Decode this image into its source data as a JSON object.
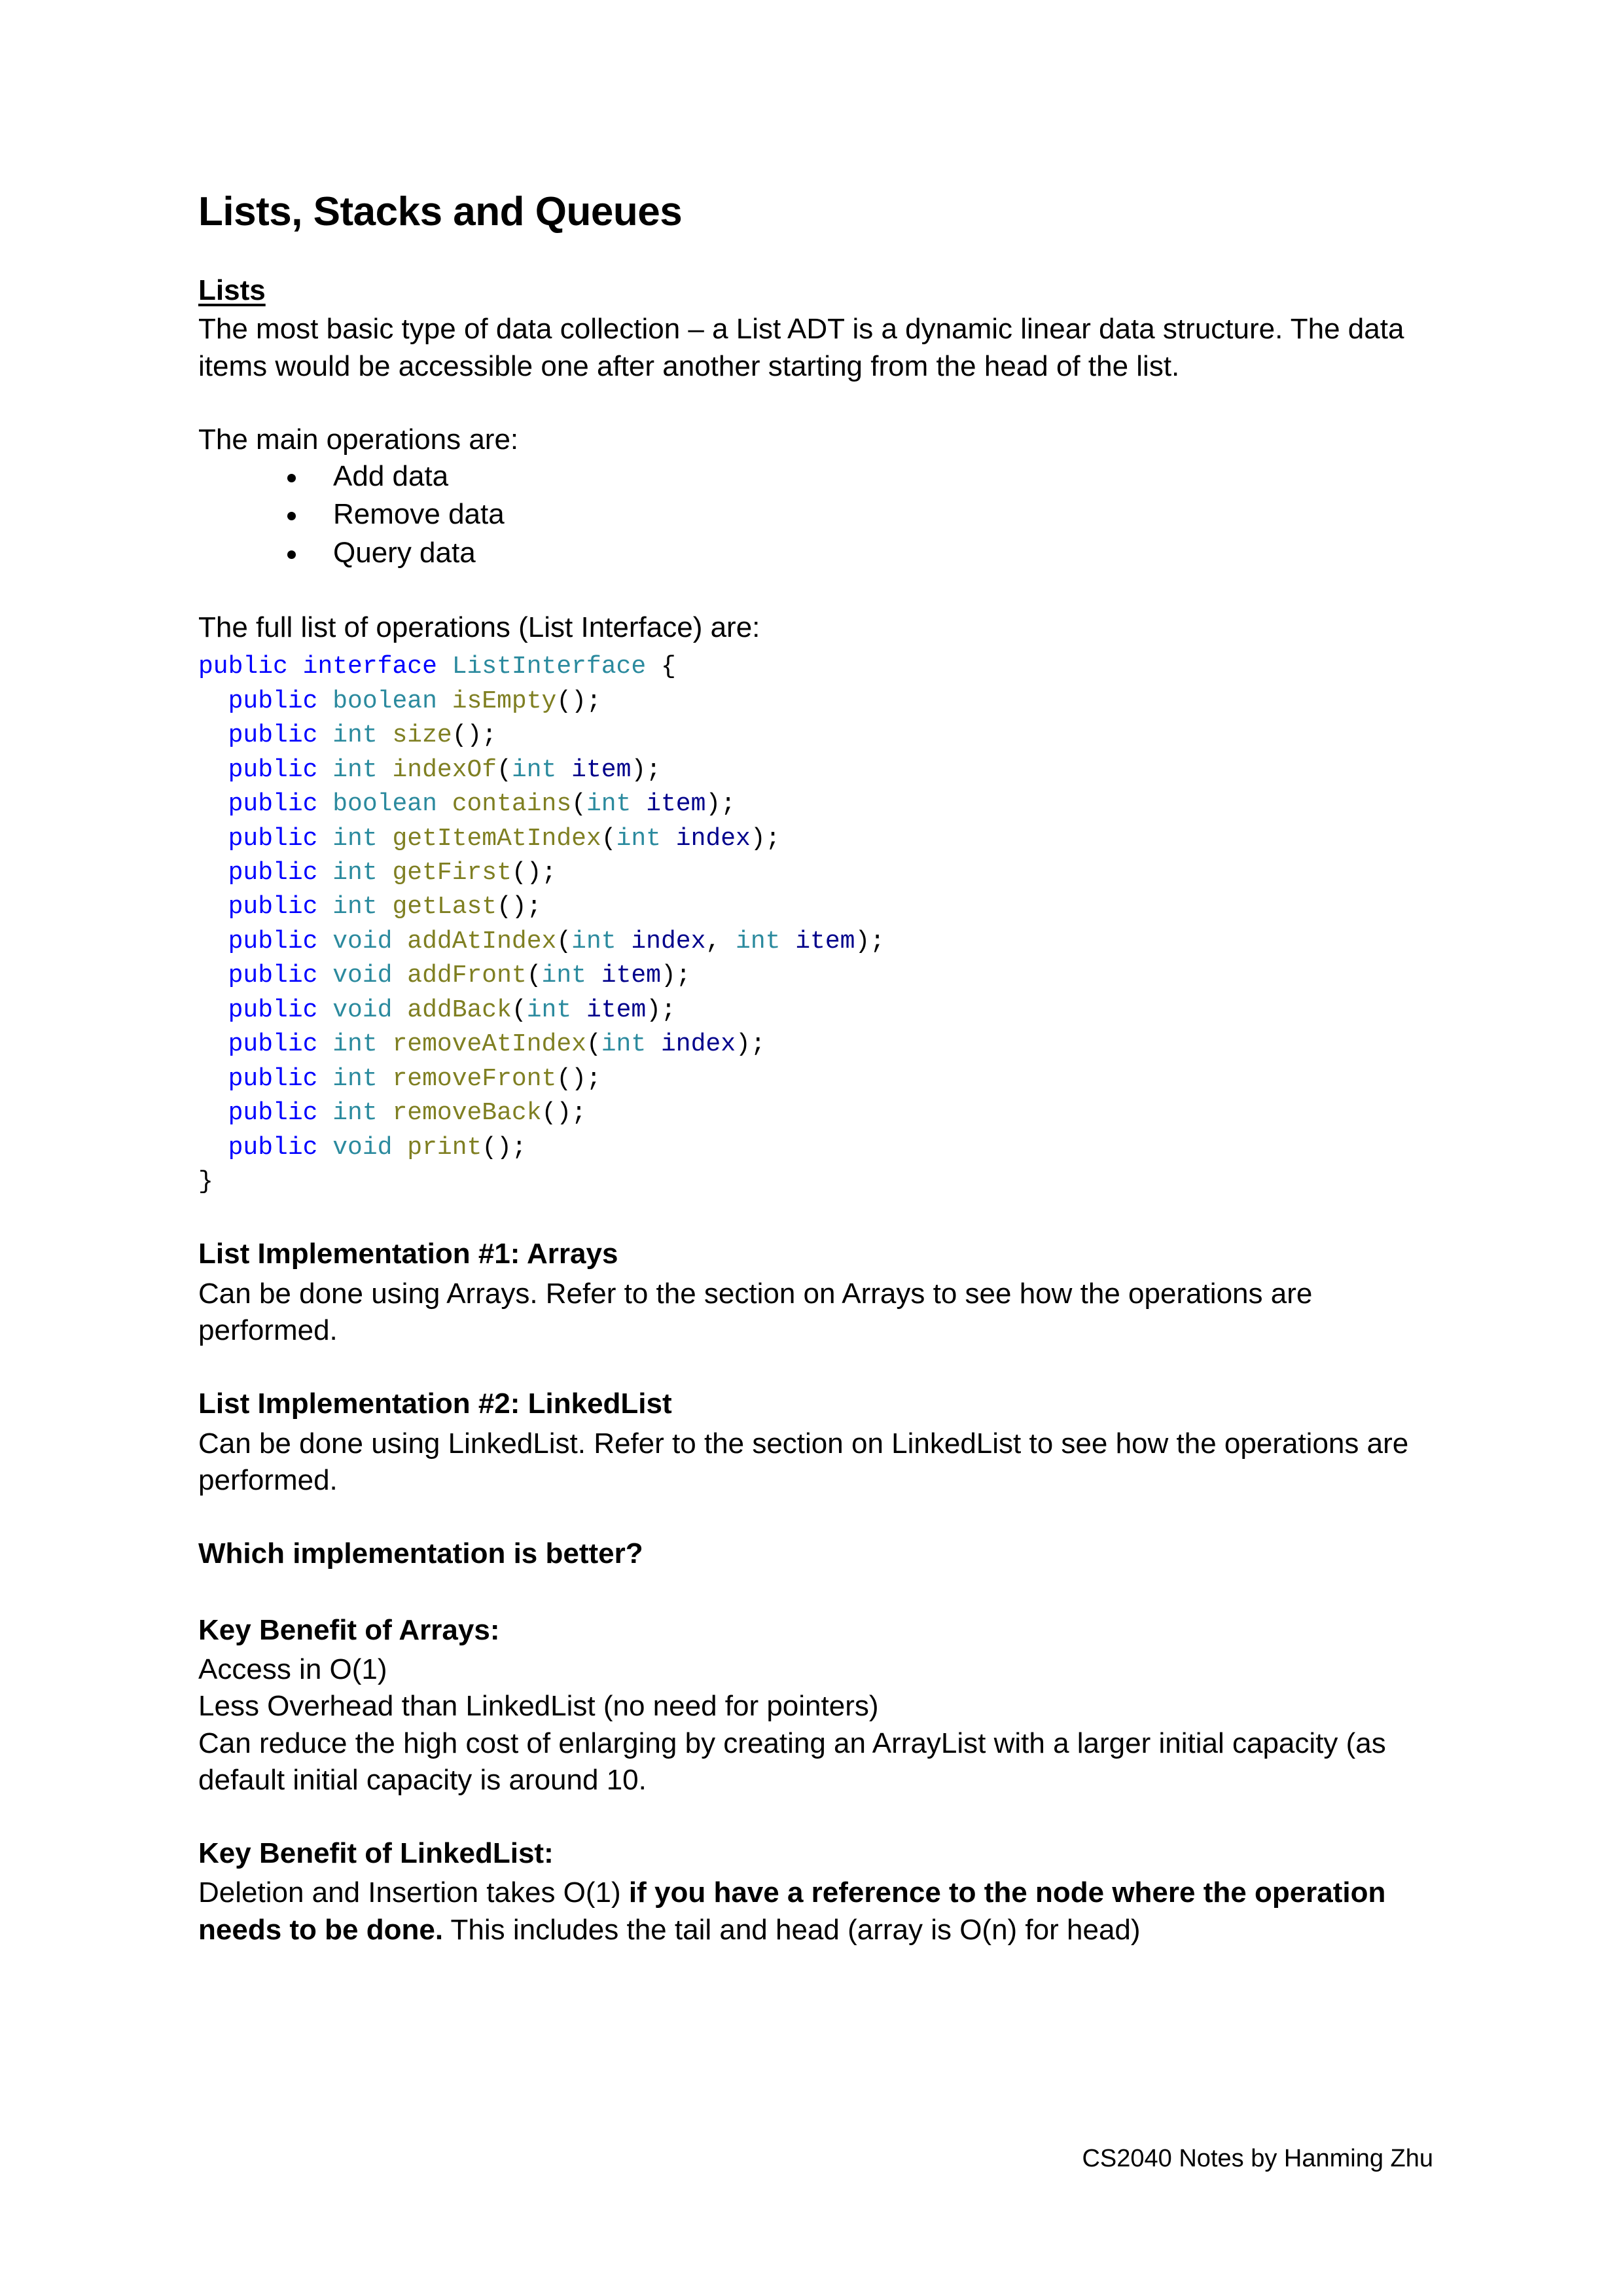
{
  "document": {
    "title": "Lists, Stacks and Queues",
    "footer": "CS2040 Notes by Hanming Zhu"
  },
  "sections": {
    "lists": {
      "heading": "Lists",
      "intro": "The most basic type of data collection – a List ADT is a dynamic linear data structure. The data items would be accessible one after another starting from the head of the list.",
      "operations_lead": "The main operations are:",
      "operations": [
        "Add data",
        "Remove data",
        "Query data"
      ],
      "full_list_lead": "The full list of operations (List Interface) are:"
    },
    "impl_arrays": {
      "heading": "List Implementation #1: Arrays",
      "body": "Can be done using Arrays. Refer to the section on Arrays to see how the operations are performed."
    },
    "impl_linkedlist": {
      "heading": "List Implementation #2: LinkedList",
      "body": "Can be done using LinkedList. Refer to the section on LinkedList to see how the operations are performed."
    },
    "which_better": {
      "heading": "Which implementation is better?"
    },
    "benefit_arrays": {
      "heading": "Key Benefit of Arrays:",
      "line1": "Access in O(1)",
      "line2": "Less Overhead than LinkedList (no need for pointers)",
      "line3": "Can reduce the high cost of enlarging by creating an ArrayList with a larger initial capacity (as default initial capacity is around 10."
    },
    "benefit_linkedlist": {
      "heading": "Key Benefit of LinkedList:",
      "part1": "Deletion and Insertion takes O(1) ",
      "part2_bold": "if you have a reference to the node where the operation needs to be done.",
      "part3": " This includes the tail and head (array is O(n) for head)"
    }
  },
  "code_block": {
    "language": "java",
    "colors": {
      "keyword": "#0000ff",
      "type": "#2b8a9e",
      "method": "#7f7f22",
      "parameter": "#00008b",
      "punctuation": "#000000"
    },
    "lines": [
      [
        {
          "t": "public",
          "c": "kw"
        },
        {
          "t": " ",
          "c": "pun"
        },
        {
          "t": "interface",
          "c": "kw"
        },
        {
          "t": " ",
          "c": "pun"
        },
        {
          "t": "ListInterface",
          "c": "typ"
        },
        {
          "t": " {",
          "c": "pun"
        }
      ],
      [
        {
          "t": "  ",
          "c": "pun"
        },
        {
          "t": "public",
          "c": "kw"
        },
        {
          "t": " ",
          "c": "pun"
        },
        {
          "t": "boolean",
          "c": "typ"
        },
        {
          "t": " ",
          "c": "pun"
        },
        {
          "t": "isEmpty",
          "c": "mth"
        },
        {
          "t": "();",
          "c": "pun"
        }
      ],
      [
        {
          "t": "  ",
          "c": "pun"
        },
        {
          "t": "public",
          "c": "kw"
        },
        {
          "t": " ",
          "c": "pun"
        },
        {
          "t": "int",
          "c": "typ"
        },
        {
          "t": " ",
          "c": "pun"
        },
        {
          "t": "size",
          "c": "mth"
        },
        {
          "t": "();",
          "c": "pun"
        }
      ],
      [
        {
          "t": "  ",
          "c": "pun"
        },
        {
          "t": "public",
          "c": "kw"
        },
        {
          "t": " ",
          "c": "pun"
        },
        {
          "t": "int",
          "c": "typ"
        },
        {
          "t": " ",
          "c": "pun"
        },
        {
          "t": "indexOf",
          "c": "mth"
        },
        {
          "t": "(",
          "c": "pun"
        },
        {
          "t": "int",
          "c": "typ"
        },
        {
          "t": " ",
          "c": "pun"
        },
        {
          "t": "item",
          "c": "prm"
        },
        {
          "t": ");",
          "c": "pun"
        }
      ],
      [
        {
          "t": "  ",
          "c": "pun"
        },
        {
          "t": "public",
          "c": "kw"
        },
        {
          "t": " ",
          "c": "pun"
        },
        {
          "t": "boolean",
          "c": "typ"
        },
        {
          "t": " ",
          "c": "pun"
        },
        {
          "t": "contains",
          "c": "mth"
        },
        {
          "t": "(",
          "c": "pun"
        },
        {
          "t": "int",
          "c": "typ"
        },
        {
          "t": " ",
          "c": "pun"
        },
        {
          "t": "item",
          "c": "prm"
        },
        {
          "t": ");",
          "c": "pun"
        }
      ],
      [
        {
          "t": "  ",
          "c": "pun"
        },
        {
          "t": "public",
          "c": "kw"
        },
        {
          "t": " ",
          "c": "pun"
        },
        {
          "t": "int",
          "c": "typ"
        },
        {
          "t": " ",
          "c": "pun"
        },
        {
          "t": "getItemAtIndex",
          "c": "mth"
        },
        {
          "t": "(",
          "c": "pun"
        },
        {
          "t": "int",
          "c": "typ"
        },
        {
          "t": " ",
          "c": "pun"
        },
        {
          "t": "index",
          "c": "prm"
        },
        {
          "t": ");",
          "c": "pun"
        }
      ],
      [
        {
          "t": "  ",
          "c": "pun"
        },
        {
          "t": "public",
          "c": "kw"
        },
        {
          "t": " ",
          "c": "pun"
        },
        {
          "t": "int",
          "c": "typ"
        },
        {
          "t": " ",
          "c": "pun"
        },
        {
          "t": "getFirst",
          "c": "mth"
        },
        {
          "t": "();",
          "c": "pun"
        }
      ],
      [
        {
          "t": "  ",
          "c": "pun"
        },
        {
          "t": "public",
          "c": "kw"
        },
        {
          "t": " ",
          "c": "pun"
        },
        {
          "t": "int",
          "c": "typ"
        },
        {
          "t": " ",
          "c": "pun"
        },
        {
          "t": "getLast",
          "c": "mth"
        },
        {
          "t": "();",
          "c": "pun"
        }
      ],
      [
        {
          "t": "  ",
          "c": "pun"
        },
        {
          "t": "public",
          "c": "kw"
        },
        {
          "t": " ",
          "c": "pun"
        },
        {
          "t": "void",
          "c": "typ"
        },
        {
          "t": " ",
          "c": "pun"
        },
        {
          "t": "addAtIndex",
          "c": "mth"
        },
        {
          "t": "(",
          "c": "pun"
        },
        {
          "t": "int",
          "c": "typ"
        },
        {
          "t": " ",
          "c": "pun"
        },
        {
          "t": "index",
          "c": "prm"
        },
        {
          "t": ", ",
          "c": "pun"
        },
        {
          "t": "int",
          "c": "typ"
        },
        {
          "t": " ",
          "c": "pun"
        },
        {
          "t": "item",
          "c": "prm"
        },
        {
          "t": ");",
          "c": "pun"
        }
      ],
      [
        {
          "t": "  ",
          "c": "pun"
        },
        {
          "t": "public",
          "c": "kw"
        },
        {
          "t": " ",
          "c": "pun"
        },
        {
          "t": "void",
          "c": "typ"
        },
        {
          "t": " ",
          "c": "pun"
        },
        {
          "t": "addFront",
          "c": "mth"
        },
        {
          "t": "(",
          "c": "pun"
        },
        {
          "t": "int",
          "c": "typ"
        },
        {
          "t": " ",
          "c": "pun"
        },
        {
          "t": "item",
          "c": "prm"
        },
        {
          "t": ");",
          "c": "pun"
        }
      ],
      [
        {
          "t": "  ",
          "c": "pun"
        },
        {
          "t": "public",
          "c": "kw"
        },
        {
          "t": " ",
          "c": "pun"
        },
        {
          "t": "void",
          "c": "typ"
        },
        {
          "t": " ",
          "c": "pun"
        },
        {
          "t": "addBack",
          "c": "mth"
        },
        {
          "t": "(",
          "c": "pun"
        },
        {
          "t": "int",
          "c": "typ"
        },
        {
          "t": " ",
          "c": "pun"
        },
        {
          "t": "item",
          "c": "prm"
        },
        {
          "t": ");",
          "c": "pun"
        }
      ],
      [
        {
          "t": "  ",
          "c": "pun"
        },
        {
          "t": "public",
          "c": "kw"
        },
        {
          "t": " ",
          "c": "pun"
        },
        {
          "t": "int",
          "c": "typ"
        },
        {
          "t": " ",
          "c": "pun"
        },
        {
          "t": "removeAtIndex",
          "c": "mth"
        },
        {
          "t": "(",
          "c": "pun"
        },
        {
          "t": "int",
          "c": "typ"
        },
        {
          "t": " ",
          "c": "pun"
        },
        {
          "t": "index",
          "c": "prm"
        },
        {
          "t": ");",
          "c": "pun"
        }
      ],
      [
        {
          "t": "  ",
          "c": "pun"
        },
        {
          "t": "public",
          "c": "kw"
        },
        {
          "t": " ",
          "c": "pun"
        },
        {
          "t": "int",
          "c": "typ"
        },
        {
          "t": " ",
          "c": "pun"
        },
        {
          "t": "removeFront",
          "c": "mth"
        },
        {
          "t": "();",
          "c": "pun"
        }
      ],
      [
        {
          "t": "  ",
          "c": "pun"
        },
        {
          "t": "public",
          "c": "kw"
        },
        {
          "t": " ",
          "c": "pun"
        },
        {
          "t": "int",
          "c": "typ"
        },
        {
          "t": " ",
          "c": "pun"
        },
        {
          "t": "removeBack",
          "c": "mth"
        },
        {
          "t": "();",
          "c": "pun"
        }
      ],
      [
        {
          "t": "  ",
          "c": "pun"
        },
        {
          "t": "public",
          "c": "kw"
        },
        {
          "t": " ",
          "c": "pun"
        },
        {
          "t": "void",
          "c": "typ"
        },
        {
          "t": " ",
          "c": "pun"
        },
        {
          "t": "print",
          "c": "mth"
        },
        {
          "t": "();",
          "c": "pun"
        }
      ],
      [
        {
          "t": "}",
          "c": "pun"
        }
      ]
    ]
  }
}
